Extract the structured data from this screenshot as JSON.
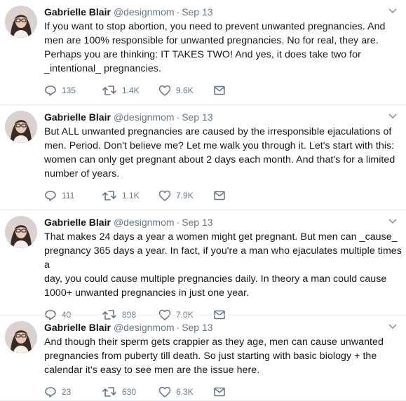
{
  "tweets": [
    {
      "name": "Gabrielle Blair",
      "handle": "@designmom",
      "separator": "·",
      "time": "Sep 13",
      "text": "If you want to stop abortion, you need to prevent unwanted pregnancies. And\nmen are 100% responsible for unwanted pregnancies. No for real, they are.\nPerhaps you are thinking: IT TAKES TWO! And yes, it does take two for\n_intentional_ pregnancies.",
      "replies": "135",
      "retweets": "1.4K",
      "likes": "9.6K"
    },
    {
      "name": "Gabrielle Blair",
      "handle": "@designmom",
      "separator": "·",
      "time": "Sep 13",
      "text": "But ALL unwanted pregnancies are caused by the irresponsible ejaculations of\nmen. Period. Don't believe me? Let me walk you through it. Let's start with this:\nwomen can only get pregnant about 2 days each month. And that's for a limited\nnumber of years.",
      "replies": "111",
      "retweets": "1.1K",
      "likes": "7.9K"
    },
    {
      "name": "Gabrielle Blair",
      "handle": "@designmom",
      "separator": "·",
      "time": "Sep 13",
      "text": "That makes 24 days a year a women might get pregnant. But men can _cause_\npregnancy 365 days a year. In fact, if you're a man who ejaculates multiple times a\nday, you could cause multiple pregnancies daily. In theory a man could cause\n1000+ unwanted pregnancies in just one year.",
      "replies": "40",
      "retweets": "898",
      "likes": "7.0K"
    },
    {
      "name": "Gabrielle Blair",
      "handle": "@designmom",
      "separator": "·",
      "time": "Sep 13",
      "text": "And though their sperm gets crappier as they age, men can cause unwanted\npregnancies from puberty till death. So just starting with basic biology + the\ncalendar it's easy to see men are the issue here.",
      "replies": "23",
      "retweets": "630",
      "likes": "6.3K"
    }
  ],
  "icons": {
    "reply": "reply-icon",
    "retweet": "retweet-icon",
    "like": "heart-icon",
    "dm": "envelope-icon",
    "caret": "chevron-down-icon"
  },
  "colors": {
    "text": "#14171a",
    "muted": "#657786",
    "divider": "#e6ecf0"
  }
}
